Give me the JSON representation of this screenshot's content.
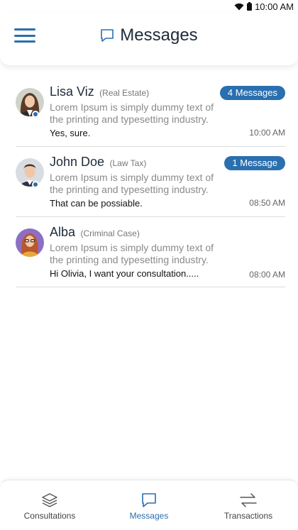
{
  "status_bar": {
    "time": "10:00 AM"
  },
  "header": {
    "title": "Messages",
    "accent_color": "#2a6faf"
  },
  "messages": [
    {
      "name": "Lisa Viz",
      "category": "(Real Estate)",
      "badge": "4 Messages",
      "preview": "Lorem Ipsum is simply dummy text of the printing and typesetting industry.",
      "last_message": "Yes, sure.",
      "time": "10:00 AM",
      "online": true
    },
    {
      "name": "John Doe",
      "category": "(Law Tax)",
      "badge": "1 Message",
      "preview": "Lorem Ipsum is simply dummy text of the printing and typesetting industry.",
      "last_message": "That can be possiable.",
      "time": "08:50 AM",
      "online": true
    },
    {
      "name": "Alba",
      "category": "(Criminal Case)",
      "badge": "",
      "preview": "Lorem Ipsum is simply dummy text of the printing and typesetting industry.",
      "last_message": "Hi Olivia, I want your  consultation.....",
      "time": "08:00 AM",
      "online": false
    }
  ],
  "bottom_nav": {
    "items": [
      {
        "label": "Consultations",
        "icon": "layers-icon"
      },
      {
        "label": "Messages",
        "icon": "chat-icon",
        "active": true
      },
      {
        "label": "Transactions",
        "icon": "transfer-arrows-icon"
      }
    ]
  }
}
